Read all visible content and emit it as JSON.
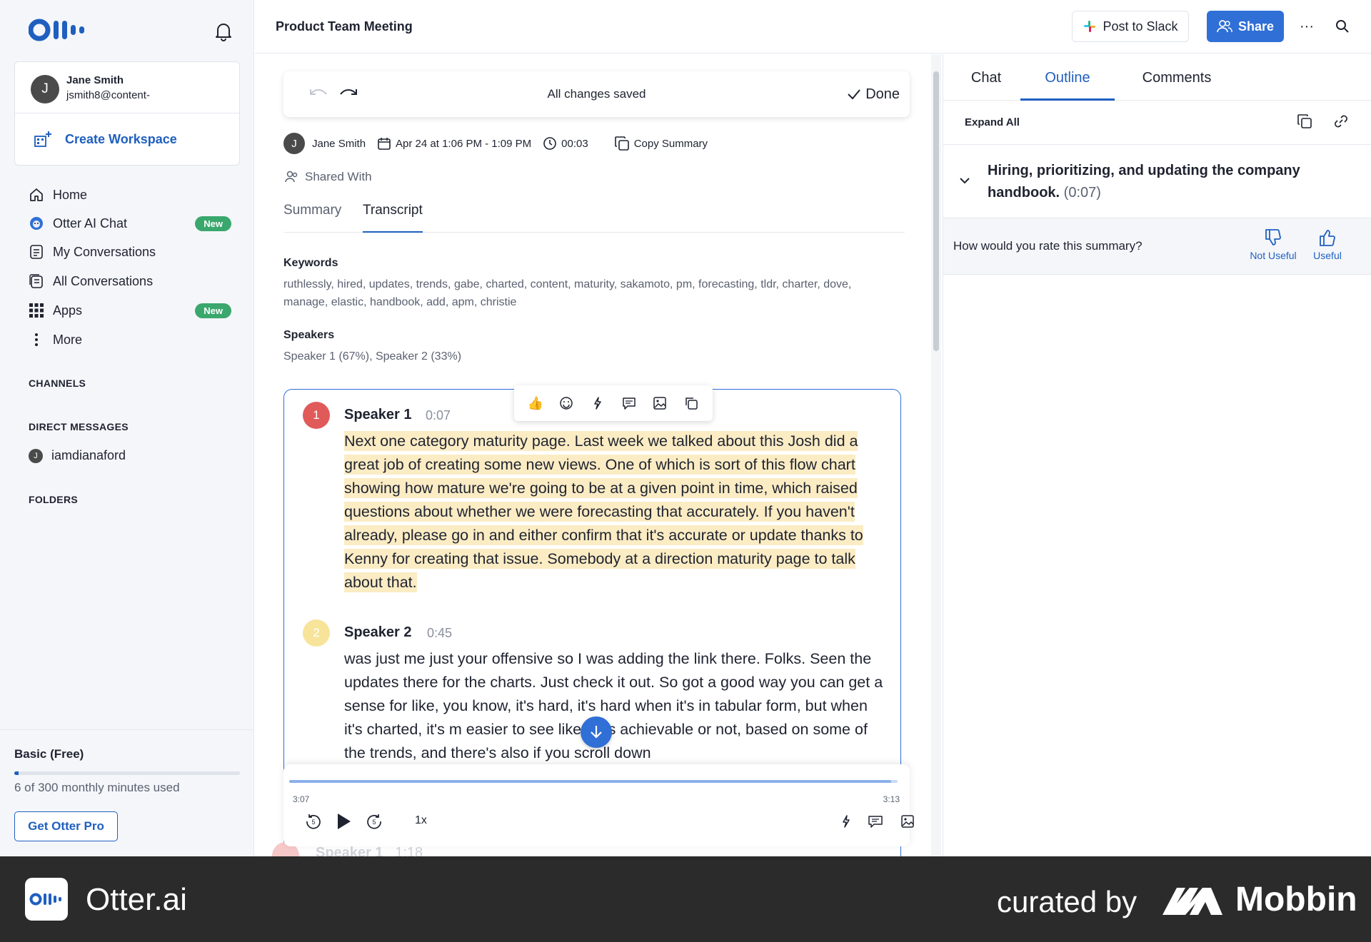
{
  "app": {
    "name": "Otter.ai"
  },
  "sidebar": {
    "account": {
      "avatar_initial": "J",
      "name": "Jane Smith",
      "email": "jsmith8@content-"
    },
    "create_workspace": "Create Workspace",
    "nav": [
      {
        "label": "Home",
        "icon": "home-icon"
      },
      {
        "label": "Otter AI Chat",
        "icon": "otter-chat-icon",
        "badge": "New"
      },
      {
        "label": "My Conversations",
        "icon": "conversations-icon"
      },
      {
        "label": "All Conversations",
        "icon": "all-conversations-icon"
      },
      {
        "label": "Apps",
        "icon": "apps-grid-icon",
        "badge": "New"
      },
      {
        "label": "More",
        "icon": "more-vertical-icon"
      }
    ],
    "channels_heading": "CHANNELS",
    "dm_heading": "DIRECT MESSAGES",
    "dm_user": {
      "initial": "J",
      "name": "iamdianaford"
    },
    "folders_heading": "FOLDERS",
    "plan": {
      "name": "Basic (Free)",
      "usage": "6 of 300 monthly minutes used",
      "used_fraction": 0.02,
      "cta": "Get Otter Pro"
    }
  },
  "header": {
    "title": "Product Team Meeting",
    "post_slack": "Post to Slack",
    "share": "Share",
    "more": "···"
  },
  "editbar": {
    "status": "All changes saved",
    "done": "Done"
  },
  "meta": {
    "avatar_initial": "J",
    "owner": "Jane Smith",
    "date": "Apr 24 at 1:06 PM - 1:09 PM",
    "duration": "00:03",
    "copy_summary": "Copy Summary",
    "shared_with": "Shared With"
  },
  "content_tabs": [
    {
      "label": "Summary",
      "active": false
    },
    {
      "label": "Transcript",
      "active": true
    }
  ],
  "keywords": {
    "heading": "Keywords",
    "text": "ruthlessly, hired, updates, trends, gabe, charted, content, maturity, sakamoto, pm, forecasting, tldr, charter, dove, manage, elastic, handbook, add, apm, christie"
  },
  "speakers": {
    "heading": "Speakers",
    "text": "Speaker 1 (67%), Speaker 2 (33%)"
  },
  "transcript": [
    {
      "number": "1",
      "speaker": "Speaker 1",
      "time": "0:07",
      "color": "#e05a5a",
      "text": "Next one category maturity page. Last week we talked about this Josh did a great job of creating some new views. One of which is sort of this flow chart showing how mature we're going to be at a given point in time, which raised questions about whether we were forecasting that accurately. If you haven't already, please go in and either confirm that it's accurate or update thanks to Kenny for creating that issue. Somebody at a direction maturity page to talk about that."
    },
    {
      "number": "2",
      "speaker": "Speaker 2",
      "time": "0:45",
      "color": "#f2d35a",
      "text": "was just me just your offensive so I was adding the link there. Folks. Seen the updates there for the charts. Just check it out. So got a good way you can get a sense for like, you know, it's hard, it's hard when it's in tabular form, but when it's charted, it's m easier to see like if it's achievable or not, based on some of the trends, and there's also if you scroll down"
    }
  ],
  "ghost_speaker": "Speaker 1",
  "ghost_time": "1:18",
  "player": {
    "current": "3:07",
    "total": "3:13",
    "progress_fraction": 0.99,
    "speed": "1x"
  },
  "right_panel": {
    "tabs": [
      {
        "label": "Chat",
        "active": false
      },
      {
        "label": "Outline",
        "active": true
      },
      {
        "label": "Comments",
        "active": false
      }
    ],
    "expand_all": "Expand All",
    "outline": {
      "title": "Hiring, prioritizing, and updating the company handbook.",
      "time": "(0:07)"
    },
    "rating": {
      "question": "How would you rate this summary?",
      "not_useful": "Not Useful",
      "useful": "Useful"
    }
  },
  "footer": {
    "app": "Otter.ai",
    "curated": "curated by",
    "brand": "Mobbin"
  },
  "colors": {
    "accent": "#1f5fbf",
    "share": "#2f6fd6",
    "highlight": "#fbecc4",
    "badge": "#3aa76d"
  }
}
